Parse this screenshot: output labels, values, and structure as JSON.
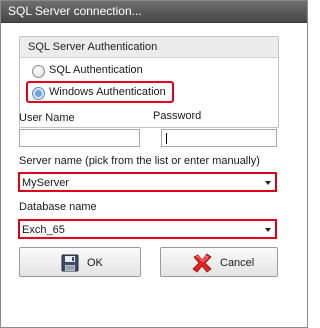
{
  "window": {
    "title": "SQL Server connection..."
  },
  "auth": {
    "group_title": "SQL Server Authentication",
    "options": [
      {
        "label": "SQL Authentication",
        "selected": false
      },
      {
        "label": "Windows Authentication",
        "selected": true
      }
    ]
  },
  "fields": {
    "username_label": "User Name",
    "username_value": "",
    "password_label": "Password",
    "password_value": "",
    "server_label": "Server name (pick from the list or enter manually)",
    "server_value": "MyServer",
    "database_label": "Database name",
    "database_value": "Exch_65"
  },
  "buttons": {
    "ok_label": "OK",
    "cancel_label": "Cancel"
  },
  "icons": {
    "ok": "floppy-disk-icon",
    "cancel": "red-x-icon",
    "combo": "chevron-down-icon"
  },
  "colors": {
    "highlight": "#e0001a",
    "titlebar": "#5a5a5a",
    "selected_radio": "#6fa4dc"
  }
}
